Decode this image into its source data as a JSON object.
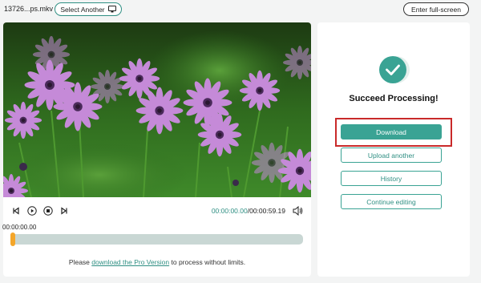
{
  "topbar": {
    "filename": "13726...ps.mkv",
    "select_label": "Select Another",
    "fullscreen_label": "Enter full-screen"
  },
  "player": {
    "current_time": "00:00:00.00",
    "separator": "/",
    "total_time": "00:00:59.19",
    "start_time": "00:00:00.00",
    "progress": 0.0
  },
  "pro_note": {
    "prefix": "Please ",
    "link": "download the Pro Version",
    "suffix": " to process without limits."
  },
  "result": {
    "title": "Succeed Processing!",
    "download_label": "Download",
    "upload_label": "Upload another",
    "history_label": "History",
    "continue_label": "Continue editing"
  },
  "colors": {
    "accent": "#3aa394",
    "highlight": "#c92a2a",
    "handle": "#f4a62a"
  }
}
